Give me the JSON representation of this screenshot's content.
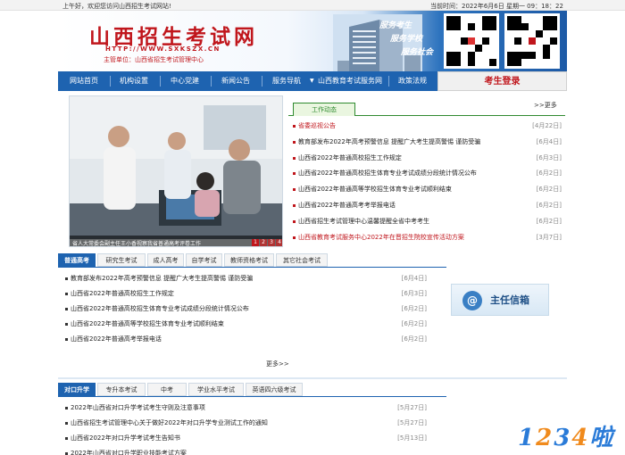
{
  "topbar": {
    "greeting": "上午好，欢迎您访问山西招生考试网站!",
    "datetime": "当前时间：2022年6月6日 星期一 09：18：22"
  },
  "header": {
    "title": "山西招生考试网",
    "url": "HTTP://WWW.SXKSZX.CN",
    "sponsor": "主管单位：山西省招生考试管理中心",
    "slogans": [
      "服务考生",
      "服务学校",
      "服务社会"
    ]
  },
  "nav": {
    "items": [
      "网站首页",
      "机构设置",
      "中心党建",
      "新闻公告",
      "服务导航",
      "山西教育考试服务网",
      "政策法规"
    ],
    "login": "考生登录"
  },
  "slide": {
    "caption": "省人大常委会副主任王小香视察我省普通高考评卷工作",
    "dots": [
      "1",
      "2",
      "3",
      "4"
    ]
  },
  "work_news": {
    "tab": "工作动态",
    "more": ">>更多",
    "items": [
      {
        "title": "省委巡视公告",
        "date": "[4月22日]",
        "color": "#c0161c"
      },
      {
        "title": "教育部发布2022年高考预警信息 提醒广大考生提高警惕 谨防受骗",
        "date": "[6月4日]",
        "color": "#222222"
      },
      {
        "title": "山西省2022年普通高校招生工作规定",
        "date": "[6月3日]",
        "color": "#222222"
      },
      {
        "title": "山西省2022年普通高校招生体育专业考试成绩分段统计情况公布",
        "date": "[6月2日]",
        "color": "#222222"
      },
      {
        "title": "山西省2022年普通高等学校招生体育专业考试顺利结束",
        "date": "[6月2日]",
        "color": "#222222"
      },
      {
        "title": "山西省2022年普通高考考举报电话",
        "date": "[6月2日]",
        "color": "#222222"
      },
      {
        "title": "山西省招生考试管理中心温馨提醒全省中考考生",
        "date": "[6月2日]",
        "color": "#222222"
      },
      {
        "title": "山西省教育考试服务中心2022年在晋招生院校宣传活动方案",
        "date": "[3月7日]",
        "color": "#c0161c"
      }
    ]
  },
  "exam_tabs": {
    "tabs": [
      "普通高考",
      "研究生考试",
      "成人高考",
      "自学考试",
      "教师资格考试",
      "其它社会考试"
    ],
    "items": [
      {
        "title": "教育部发布2022年高考预警信息 提醒广大考生提高警惕 谨防受骗",
        "date": "[6月4日]"
      },
      {
        "title": "山西省2022年普通高校招生工作规定",
        "date": "[6月3日]"
      },
      {
        "title": "山西省2022年普通高校招生体育专业考试成绩分段统计情况公布",
        "date": "[6月2日]"
      },
      {
        "title": "山西省2022年普通高等学校招生体育专业考试顺利结束",
        "date": "[6月2日]"
      },
      {
        "title": "山西省2022年普通高考举报电话",
        "date": "[6月2日]"
      }
    ],
    "more": "更多>>"
  },
  "mailbox": {
    "icon": "@",
    "label": "主任信箱"
  },
  "vocational_tabs": {
    "tabs": [
      "对口升学",
      "专升本考试",
      "中考",
      "学业水平考试",
      "英语四六级考试"
    ],
    "items": [
      {
        "title": "2022年山西省对口升学考试考生守则及注意事项",
        "date": "[5月27日]"
      },
      {
        "title": "山西省招生考试管理中心关于做好2022年对口升学专业测试工作的通知",
        "date": "[5月27日]"
      },
      {
        "title": "山西省2022年对口升学考试考生告知书",
        "date": "[5月13日]"
      },
      {
        "title": "2022年山西省对口升学职业技能考试方案",
        "date": ""
      }
    ]
  },
  "watermark": [
    "1",
    "2",
    "3",
    "4",
    "啦"
  ]
}
